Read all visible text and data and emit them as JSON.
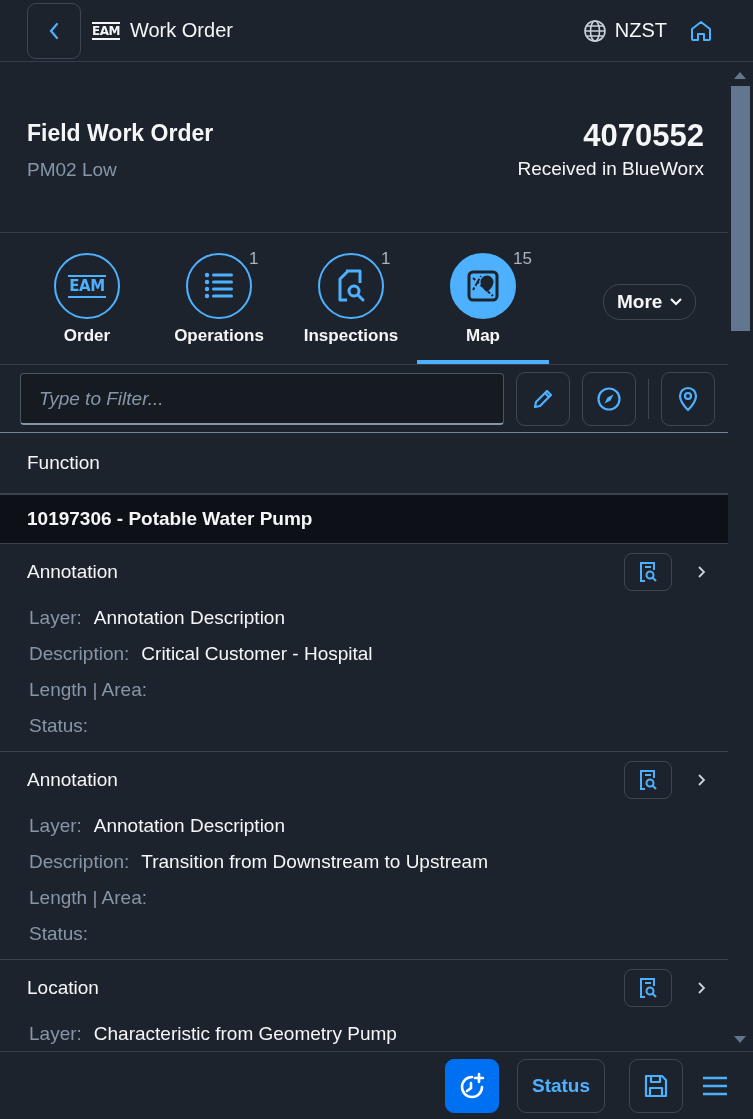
{
  "header": {
    "logo": "EAM",
    "title": "Work Order",
    "timezone": "NZST"
  },
  "order": {
    "title": "Field Work Order",
    "subtitle": "PM02 Low",
    "number": "4070552",
    "status": "Received in BlueWorx"
  },
  "tabs": [
    {
      "label": "Order",
      "kind": "eam",
      "icon_text": "EAM",
      "selected": false
    },
    {
      "label": "Operations",
      "kind": "list",
      "count": "1",
      "selected": false
    },
    {
      "label": "Inspections",
      "kind": "inspect",
      "count": "1",
      "selected": false
    },
    {
      "label": "Map",
      "kind": "map",
      "count": "15",
      "selected": true
    }
  ],
  "more_button": "More",
  "filter": {
    "placeholder": "Type to Filter..."
  },
  "section_header": "Function",
  "group_header": "10197306 - Potable Water Pump",
  "features": [
    {
      "title": "Annotation",
      "fields": [
        {
          "label": "Layer:",
          "value": "Annotation Description"
        },
        {
          "label": "Description:",
          "value": "Critical Customer - Hospital"
        },
        {
          "label": "Length | Area:"
        },
        {
          "label": "Status:"
        }
      ]
    },
    {
      "title": "Annotation",
      "fields": [
        {
          "label": "Layer:",
          "value": "Annotation Description"
        },
        {
          "label": "Description:",
          "value": "Transition from Downstream to Upstream"
        },
        {
          "label": "Length | Area:"
        },
        {
          "label": "Status:"
        }
      ]
    },
    {
      "title": "Location",
      "fields": [
        {
          "label": "Layer:",
          "value": "Characteristic from Geometry Pump"
        }
      ]
    }
  ],
  "footer": {
    "status_button": "Status"
  }
}
